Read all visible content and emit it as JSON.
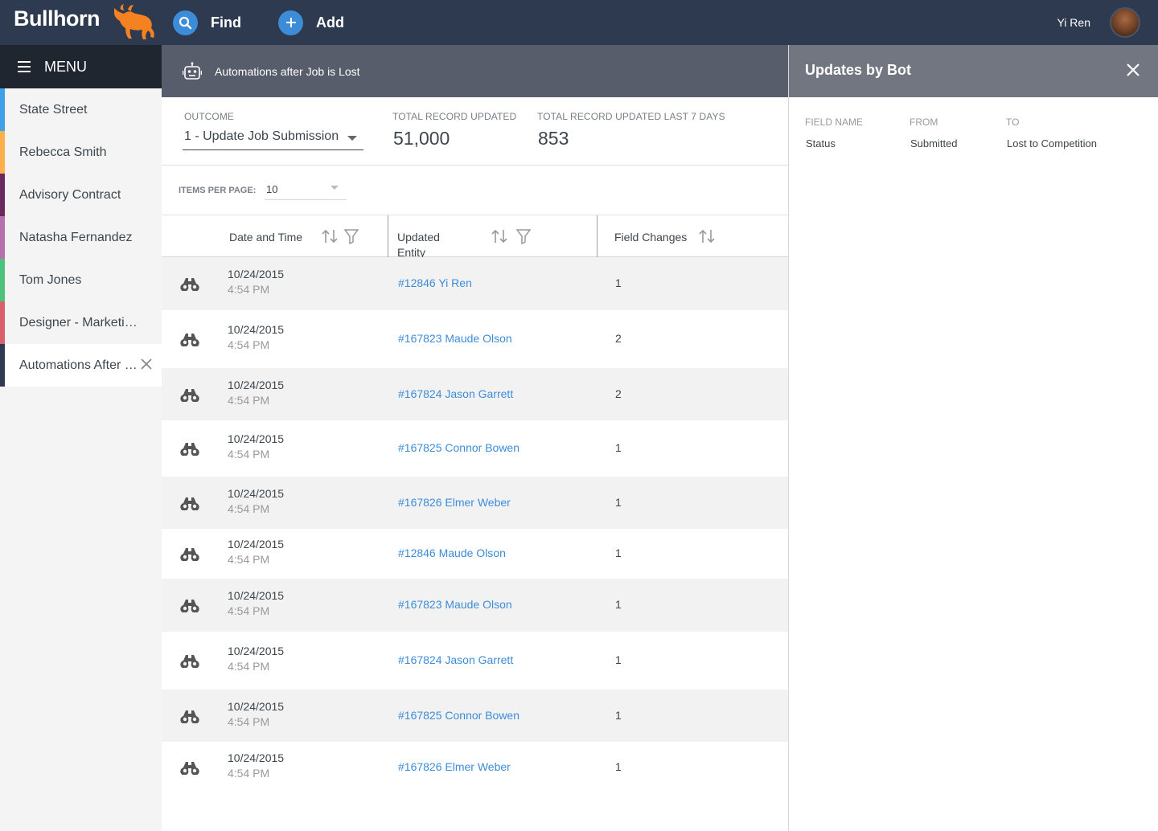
{
  "topbar": {
    "logo": "Bullhorn",
    "find_label": "Find",
    "add_label": "Add",
    "user_name": "Yi Ren"
  },
  "sidebar": {
    "menu_label": "MENU",
    "items": [
      {
        "label": "State Street",
        "color": "#3da2e8"
      },
      {
        "label": "Rebecca Smith",
        "color": "#ffb04c"
      },
      {
        "label": "Advisory Contract",
        "color": "#6b2a5d"
      },
      {
        "label": "Natasha Fernandez",
        "color": "#b86fb0"
      },
      {
        "label": "Tom Jones",
        "color": "#4cc27a"
      },
      {
        "label": "Designer - Marketing",
        "color": "#d9606d"
      },
      {
        "label": "Automations After Job is Lost",
        "color": "#2e3a4f"
      }
    ]
  },
  "main": {
    "header_title": "Automations after Job is Lost",
    "outcome": {
      "label": "OUTCOME",
      "value": "1 - Update Job Submission"
    },
    "total_updated": {
      "label": "TOTAL RECORD UPDATED",
      "value": "51,000"
    },
    "total_updated_7days": {
      "label": "TOTAL RECORD UPDATED LAST 7 DAYS",
      "value": "853"
    },
    "items_per_page": {
      "label": "ITEMS PER PAGE:",
      "value": "10"
    },
    "columns": {
      "date_time": "Date and Time",
      "updated_entity": "Updated Entity",
      "field_changes": "Field Changes"
    },
    "rows": [
      {
        "date": "10/24/2015",
        "time": "4:54 PM",
        "entity": "#12846 Yi Ren",
        "changes": "1"
      },
      {
        "date": "10/24/2015",
        "time": "4:54 PM",
        "entity": "#167823 Maude Olson",
        "changes": "2"
      },
      {
        "date": "10/24/2015",
        "time": "4:54 PM",
        "entity": "#167824 Jason Garrett",
        "changes": "2"
      },
      {
        "date": "10/24/2015",
        "time": "4:54 PM",
        "entity": "#167825 Connor Bowen",
        "changes": "1"
      },
      {
        "date": "10/24/2015",
        "time": "4:54 PM",
        "entity": "#167826 Elmer Weber",
        "changes": "1"
      },
      {
        "date": "10/24/2015",
        "time": "4:54 PM",
        "entity": "#12846 Maude Olson",
        "changes": "1"
      },
      {
        "date": "10/24/2015",
        "time": "4:54 PM",
        "entity": "#167823 Maude Olson",
        "changes": "1"
      },
      {
        "date": "10/24/2015",
        "time": "4:54 PM",
        "entity": "#167824 Jason Garrett",
        "changes": "1"
      },
      {
        "date": "10/24/2015",
        "time": "4:54 PM",
        "entity": "#167825 Connor Bowen",
        "changes": "1"
      },
      {
        "date": "10/24/2015",
        "time": "4:54 PM",
        "entity": "#167826 Elmer Weber",
        "changes": "1"
      }
    ]
  },
  "panel": {
    "title": "Updates by Bot",
    "columns": {
      "field_name": "FIELD NAME",
      "from": "FROM",
      "to": "TO"
    },
    "entry": {
      "field_name": "Status",
      "from": "Submitted",
      "to": "Lost to Competition"
    }
  },
  "icons": {
    "find": "search-icon",
    "add": "plus-icon",
    "menu": "hamburger-icon",
    "header": "robot-icon",
    "row": "binoculars-icon",
    "sort": "sort-icon",
    "filter": "filter-icon",
    "close": "close-icon"
  }
}
